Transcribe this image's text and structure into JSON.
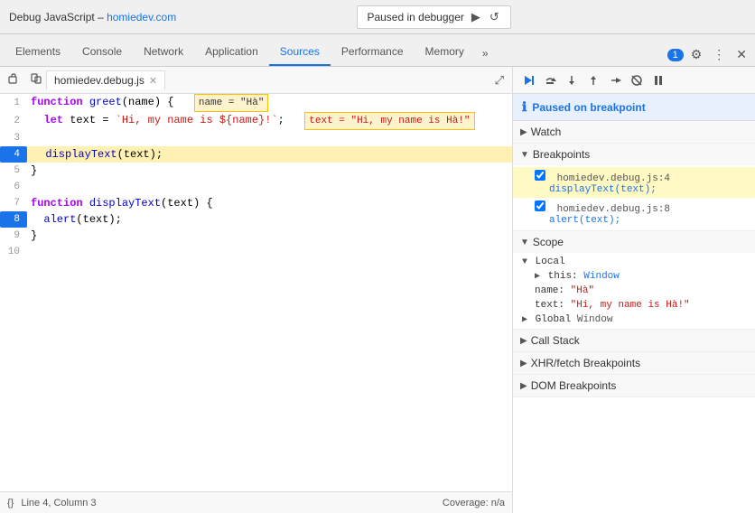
{
  "topbar": {
    "title": "Debug JavaScript",
    "link_text": "homiedev.com",
    "paused_label": "Paused in debugger"
  },
  "tabs": {
    "items": [
      {
        "label": "Elements",
        "active": false
      },
      {
        "label": "Console",
        "active": false
      },
      {
        "label": "Network",
        "active": false
      },
      {
        "label": "Application",
        "active": false
      },
      {
        "label": "Sources",
        "active": true
      },
      {
        "label": "Performance",
        "active": false
      },
      {
        "label": "Memory",
        "active": false
      }
    ],
    "overflow_label": "»",
    "badge": "1",
    "settings_icon": "⚙",
    "more_icon": "⋮",
    "close_icon": "✕"
  },
  "source_panel": {
    "nav_back": "‹",
    "nav_forward": "›",
    "file_tab": "homiedev.debug.js",
    "close_tab": "✕",
    "expand_icon": "⤢"
  },
  "code": {
    "lines": [
      {
        "num": 1,
        "content": "function greet(name) {  ",
        "tooltip": "name = \"Hà\"",
        "type": "normal"
      },
      {
        "num": 2,
        "content": "  let text = `Hi, my name is ${name}!`;  ",
        "tooltip": "text = \"Hi, my name is Hà!\"",
        "type": "normal"
      },
      {
        "num": 3,
        "content": "",
        "type": "normal"
      },
      {
        "num": 4,
        "content": "  displayText(text);",
        "type": "breakpoint-hit"
      },
      {
        "num": 5,
        "content": "}",
        "type": "normal"
      },
      {
        "num": 6,
        "content": "",
        "type": "normal"
      },
      {
        "num": 7,
        "content": "function displayText(text) {",
        "type": "normal"
      },
      {
        "num": 8,
        "content": "  alert(text);",
        "type": "breakpoint"
      },
      {
        "num": 9,
        "content": "}",
        "type": "normal"
      },
      {
        "num": 10,
        "content": "",
        "type": "normal"
      }
    ]
  },
  "statusbar": {
    "icon": "{}",
    "position": "Line 4, Column 3",
    "coverage": "Coverage: n/a"
  },
  "debugger": {
    "paused_label": "Paused on breakpoint",
    "watch_label": "Watch",
    "breakpoints_label": "Breakpoints",
    "breakpoints": [
      {
        "location": "homiedev.debug.js:4",
        "code": "displayText(text);",
        "active": true,
        "checked": true
      },
      {
        "location": "homiedev.debug.js:8",
        "code": "alert(text);",
        "active": false,
        "checked": true
      }
    ],
    "scope_label": "Scope",
    "local_label": "Local",
    "this_key": "this:",
    "this_val": "Window",
    "name_key": "name:",
    "name_val": "\"Hà\"",
    "text_key": "text:",
    "text_val": "\"Hi, my name is Hà!\"",
    "global_label": "Global",
    "global_val": "Window",
    "call_stack_label": "Call Stack",
    "xhr_label": "XHR/fetch Breakpoints",
    "dom_label": "DOM Breakpoints"
  }
}
